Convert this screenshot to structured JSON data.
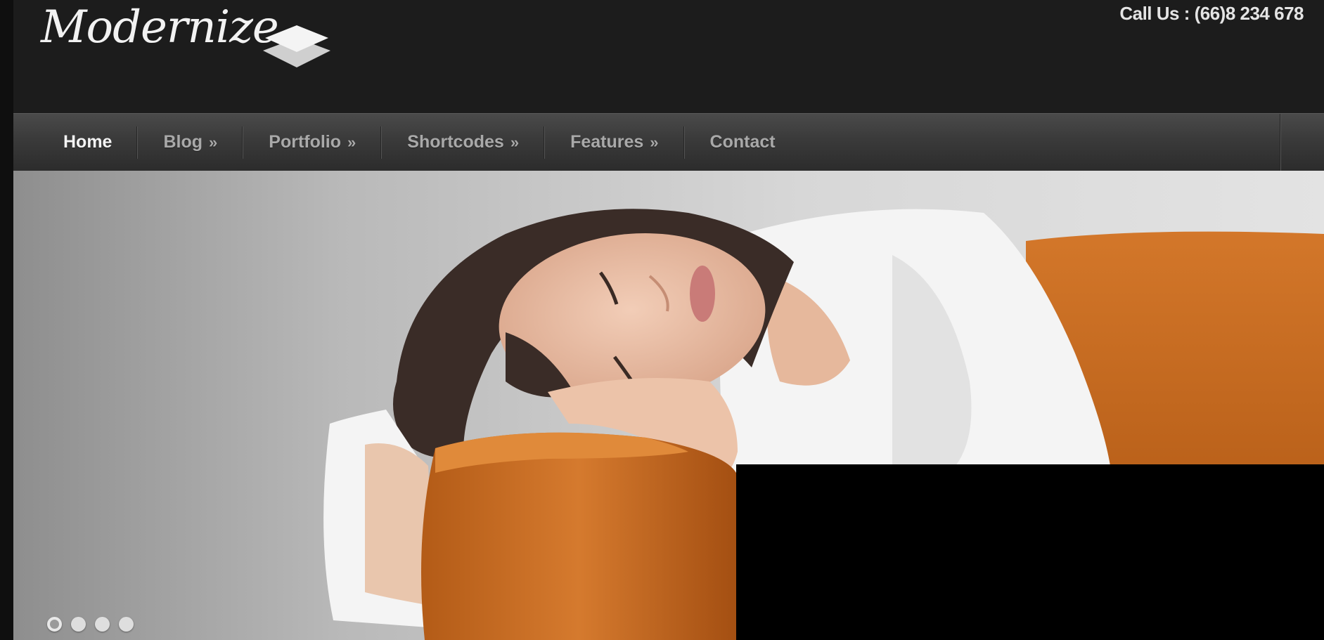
{
  "header": {
    "logo_text": "Modernize",
    "phone_text": "Call Us : (66)8 234 678"
  },
  "nav": {
    "items": [
      {
        "label": "Home",
        "arrow": "",
        "active": true
      },
      {
        "label": "Blog",
        "arrow": "»",
        "active": false
      },
      {
        "label": "Portfolio",
        "arrow": "»",
        "active": false
      },
      {
        "label": "Shortcodes",
        "arrow": "»",
        "active": false
      },
      {
        "label": "Features",
        "arrow": "»",
        "active": false
      },
      {
        "label": "Contact",
        "arrow": "",
        "active": false
      }
    ]
  },
  "slider": {
    "slide_count": 4,
    "active_slide": 1
  },
  "colors": {
    "header_bg": "#1c1c1c",
    "nav_text": "#a9a9a9",
    "nav_active_text": "#f4f4f4",
    "sofa_orange": "#c86c1e",
    "caption_box": "#000000"
  }
}
